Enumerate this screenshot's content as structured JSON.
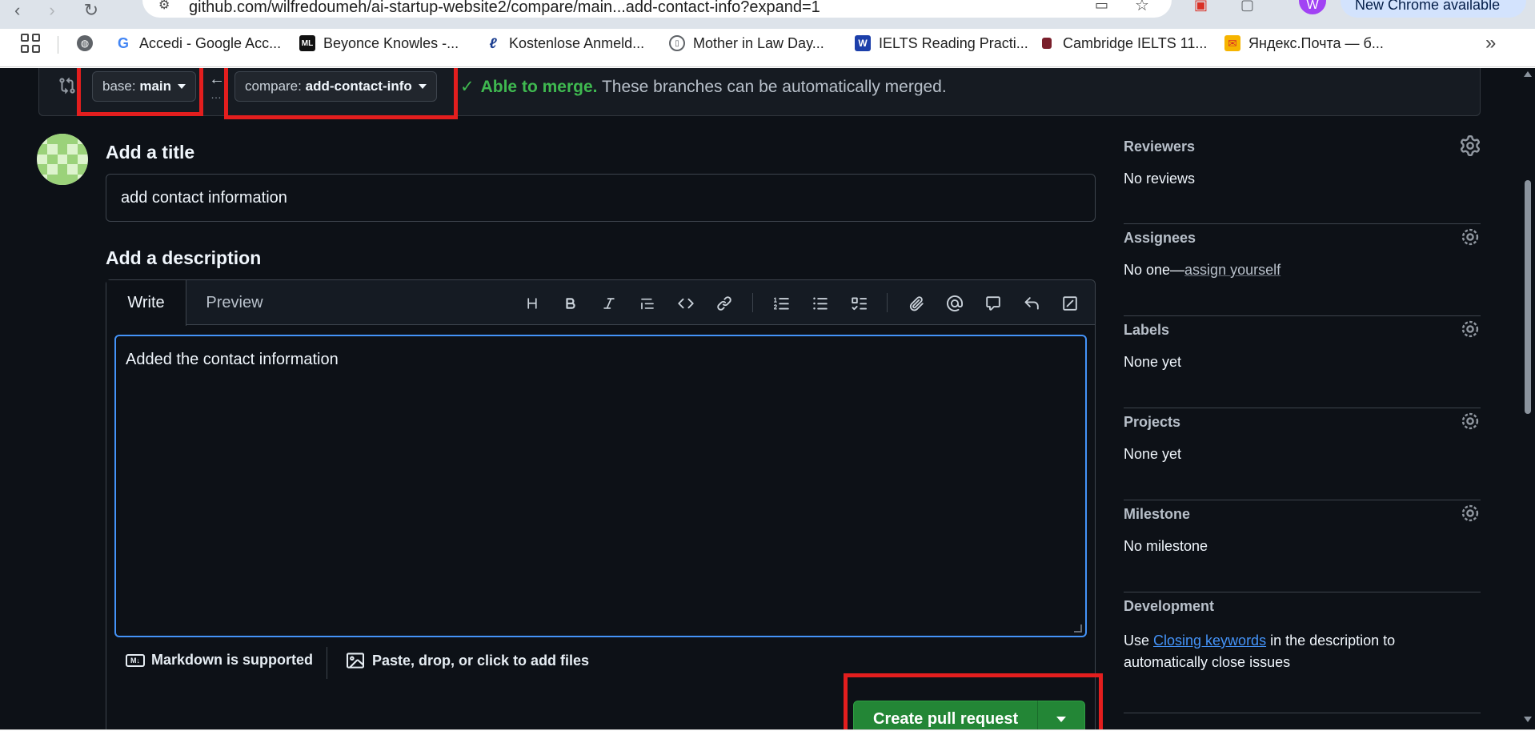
{
  "browser": {
    "url": "github.com/wilfredoumeh/ai-startup-website2/compare/main...add-contact-info?expand=1",
    "update_label": "New Chrome available",
    "profile_initial": "W",
    "bookmarks": [
      {
        "label": "Accedi - Google Acc...",
        "icon": "google-icon"
      },
      {
        "label": "Beyonce Knowles -...",
        "icon": "ml-icon"
      },
      {
        "label": "Kostenlose Anmeld...",
        "icon": "signature-icon"
      },
      {
        "label": "Mother in Law Day...",
        "icon": "page-icon"
      },
      {
        "label": "IELTS Reading Practi...",
        "icon": "ielts-icon"
      },
      {
        "label": "Cambridge IELTS 11...",
        "icon": "book-icon"
      },
      {
        "label": "Яндекс.Почта — б...",
        "icon": "mail-icon"
      }
    ]
  },
  "compare": {
    "base_prefix": "base:",
    "base_branch": "main",
    "compare_prefix": "compare:",
    "compare_branch": "add-contact-info",
    "status_ok": "Able to merge.",
    "status_text": "These branches can be automatically merged."
  },
  "form": {
    "title_label": "Add a title",
    "title_value": "add contact information",
    "description_label": "Add a description",
    "tab_write": "Write",
    "tab_preview": "Preview",
    "toolbar": [
      "heading-icon",
      "bold-icon",
      "italic-icon",
      "quote-icon",
      "code-icon",
      "link-icon",
      "ordered-list-icon",
      "unordered-list-icon",
      "task-list-icon",
      "attach-icon",
      "mention-icon",
      "reference-icon",
      "reply-icon",
      "slash-command-icon"
    ],
    "description_value": "Added the contact information",
    "markdown_note": "Markdown is supported",
    "attach_note": "Paste, drop, or click to add files",
    "create_button": "Create pull request"
  },
  "sidebar": {
    "reviewers": {
      "title": "Reviewers",
      "value": "No reviews"
    },
    "assignees": {
      "title": "Assignees",
      "value_prefix": "No one—",
      "value_link": "assign yourself"
    },
    "labels": {
      "title": "Labels",
      "value": "None yet"
    },
    "projects": {
      "title": "Projects",
      "value": "None yet"
    },
    "milestone": {
      "title": "Milestone",
      "value": "No milestone"
    },
    "development": {
      "title": "Development",
      "text_prefix": "Use ",
      "text_link": "Closing keywords",
      "text_suffix": " in the description to automatically close issues"
    }
  },
  "colors": {
    "page_bg": "#0d1117",
    "accent_green": "#238636",
    "status_green": "#3fb950",
    "link_blue": "#4493f8",
    "annotation_red": "#e31e1e"
  }
}
